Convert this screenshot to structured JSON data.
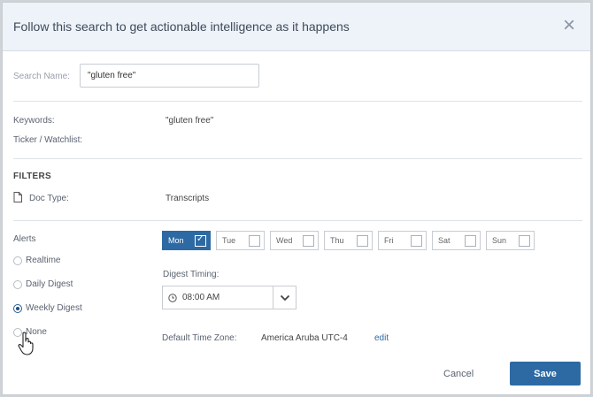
{
  "modal": {
    "title": "Follow this search to get actionable intelligence as it happens",
    "close_icon": "close-icon"
  },
  "search": {
    "label": "Search Name:",
    "value": "\"gluten free\""
  },
  "details": {
    "keywords_label": "Keywords:",
    "keywords_value": "\"gluten free\"",
    "ticker_label": "Ticker / Watchlist:"
  },
  "filters": {
    "title": "FILTERS",
    "doc_type_label": "Doc Type:",
    "doc_type_value": "Transcripts",
    "doc_icon": "document-icon"
  },
  "alerts": {
    "label": "Alerts",
    "options": [
      {
        "label": "Realtime",
        "checked": false
      },
      {
        "label": "Daily Digest",
        "checked": false
      },
      {
        "label": "Weekly Digest",
        "checked": true
      },
      {
        "label": "None",
        "checked": false
      }
    ]
  },
  "days": [
    {
      "label": "Mon",
      "checked": true
    },
    {
      "label": "Tue",
      "checked": false
    },
    {
      "label": "Wed",
      "checked": false
    },
    {
      "label": "Thu",
      "checked": false
    },
    {
      "label": "Fri",
      "checked": false
    },
    {
      "label": "Sat",
      "checked": false
    },
    {
      "label": "Sun",
      "checked": false
    }
  ],
  "digest": {
    "label": "Digest Timing:",
    "time": "08:00 AM",
    "clock_icon": "clock-icon",
    "arrow_icon": "chevron-down-icon"
  },
  "timezone": {
    "label": "Default Time Zone:",
    "value": "America Aruba UTC-4",
    "edit": "edit"
  },
  "footer": {
    "cancel": "Cancel",
    "save": "Save"
  },
  "colors": {
    "primary": "#2d6aa3",
    "header_bg": "#eef3f9"
  }
}
